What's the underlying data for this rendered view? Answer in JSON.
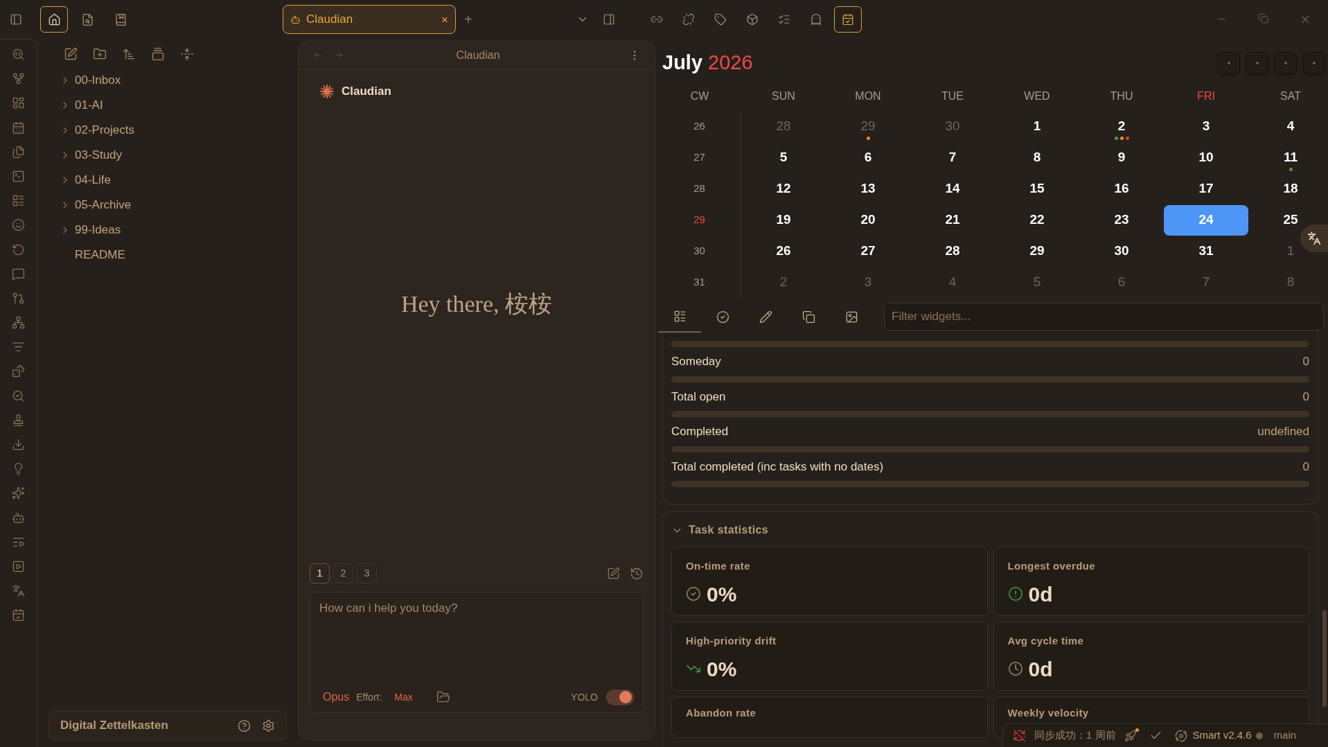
{
  "top_left_tabs": [
    {
      "selected": true
    },
    {
      "selected": false
    },
    {
      "selected": false
    }
  ],
  "tab": {
    "title": "Claudian",
    "close": "×",
    "new": "+"
  },
  "right_tools": [
    {
      "selected": false
    },
    {
      "selected": false
    },
    {
      "selected": false
    },
    {
      "selected": false
    },
    {
      "selected": false
    },
    {
      "selected": false
    },
    {
      "selected": true
    }
  ],
  "explorer": {
    "items": [
      {
        "kind": "folder",
        "label": "00-Inbox",
        "expanded": false
      },
      {
        "kind": "folder",
        "label": "01-AI",
        "expanded": false
      },
      {
        "kind": "folder",
        "label": "02-Projects",
        "expanded": false
      },
      {
        "kind": "folder",
        "label": "03-Study",
        "expanded": false
      },
      {
        "kind": "folder",
        "label": "04-Life",
        "expanded": false
      },
      {
        "kind": "folder",
        "label": "05-Archive",
        "expanded": false
      },
      {
        "kind": "folder",
        "label": "99-Ideas",
        "expanded": false
      },
      {
        "kind": "file",
        "label": "README"
      }
    ],
    "vault": "Digital Zettelkasten"
  },
  "chat": {
    "header": "Claudian",
    "title": "Claudian",
    "greeting": "Hey there, 桉桉",
    "sessions": [
      {
        "label": "1",
        "selected": true
      },
      {
        "label": "2",
        "selected": false
      },
      {
        "label": "3",
        "selected": false
      }
    ],
    "placeholder": "How can i help you today?",
    "model": "Opus",
    "effort_label": "Effort:",
    "effort": "Max",
    "yolo_label": "YOLO",
    "yolo_on": true
  },
  "calendar": {
    "month": "July",
    "year": "2026",
    "headers": [
      {
        "label": "CW",
        "today": false
      },
      {
        "label": "SUN",
        "today": false
      },
      {
        "label": "MON",
        "today": false
      },
      {
        "label": "TUE",
        "today": false
      },
      {
        "label": "WED",
        "today": false
      },
      {
        "label": "THU",
        "today": false
      },
      {
        "label": "FRI",
        "today": true
      },
      {
        "label": "SAT",
        "today": false
      }
    ],
    "weeks": [
      {
        "cw": "26",
        "current": false,
        "days": [
          {
            "label": "28",
            "muted": true,
            "selected": false
          },
          {
            "label": "29",
            "muted": true,
            "selected": false,
            "dots": [
              {
                "color": "#f0901e"
              }
            ]
          },
          {
            "label": "30",
            "muted": true,
            "selected": false
          },
          {
            "label": "1",
            "muted": false,
            "selected": false
          },
          {
            "label": "2",
            "muted": false,
            "selected": false,
            "dots": [
              {
                "color": "#43a047"
              },
              {
                "color": "#f0901e"
              },
              {
                "color": "#e53935"
              }
            ]
          },
          {
            "label": "3",
            "muted": false,
            "selected": false
          },
          {
            "label": "4",
            "muted": false,
            "selected": false
          }
        ]
      },
      {
        "cw": "27",
        "current": false,
        "days": [
          {
            "label": "5",
            "muted": false,
            "selected": false
          },
          {
            "label": "6",
            "muted": false,
            "selected": false
          },
          {
            "label": "7",
            "muted": false,
            "selected": false
          },
          {
            "label": "8",
            "muted": false,
            "selected": false
          },
          {
            "label": "9",
            "muted": false,
            "selected": false
          },
          {
            "label": "10",
            "muted": false,
            "selected": false
          },
          {
            "label": "11",
            "muted": false,
            "selected": false,
            "dots": [
              {
                "color": "#43a047"
              }
            ]
          }
        ]
      },
      {
        "cw": "28",
        "current": false,
        "days": [
          {
            "label": "12",
            "muted": false,
            "selected": false
          },
          {
            "label": "13",
            "muted": false,
            "selected": false
          },
          {
            "label": "14",
            "muted": false,
            "selected": false
          },
          {
            "label": "15",
            "muted": false,
            "selected": false
          },
          {
            "label": "16",
            "muted": false,
            "selected": false
          },
          {
            "label": "17",
            "muted": false,
            "selected": false
          },
          {
            "label": "18",
            "muted": false,
            "selected": false
          }
        ]
      },
      {
        "cw": "29",
        "current": true,
        "days": [
          {
            "label": "19",
            "muted": false,
            "selected": false
          },
          {
            "label": "20",
            "muted": false,
            "selected": false
          },
          {
            "label": "21",
            "muted": false,
            "selected": false
          },
          {
            "label": "22",
            "muted": false,
            "selected": false
          },
          {
            "label": "23",
            "muted": false,
            "selected": false
          },
          {
            "label": "24",
            "muted": false,
            "selected": true
          },
          {
            "label": "25",
            "muted": false,
            "selected": false
          }
        ]
      },
      {
        "cw": "30",
        "current": false,
        "days": [
          {
            "label": "26",
            "muted": false,
            "selected": false
          },
          {
            "label": "27",
            "muted": false,
            "selected": false
          },
          {
            "label": "28",
            "muted": false,
            "selected": false
          },
          {
            "label": "29",
            "muted": false,
            "selected": false
          },
          {
            "label": "30",
            "muted": false,
            "selected": false
          },
          {
            "label": "31",
            "muted": false,
            "selected": false
          },
          {
            "label": "1",
            "muted": true,
            "selected": false
          }
        ]
      },
      {
        "cw": "31",
        "current": false,
        "days": [
          {
            "label": "2",
            "muted": true,
            "selected": false
          },
          {
            "label": "3",
            "muted": true,
            "selected": false
          },
          {
            "label": "4",
            "muted": true,
            "selected": false
          },
          {
            "label": "5",
            "muted": true,
            "selected": false
          },
          {
            "label": "6",
            "muted": true,
            "selected": false
          },
          {
            "label": "7",
            "muted": true,
            "selected": false
          },
          {
            "label": "8",
            "muted": true,
            "selected": false
          }
        ]
      }
    ]
  },
  "widget_tabs": [
    {
      "selected": true
    },
    {
      "selected": false
    },
    {
      "selected": false
    },
    {
      "selected": false
    },
    {
      "selected": false
    }
  ],
  "filter": {
    "placeholder": "Filter widgets..."
  },
  "stats": [
    {
      "label": "Someday",
      "value": "0",
      "level": 0
    },
    {
      "label": "Total open",
      "value": "0",
      "level": 0
    },
    {
      "label": "Completed",
      "value": "undefined",
      "level": 0
    },
    {
      "label": "Total completed (inc tasks with no dates)",
      "value": "0",
      "level": 0
    }
  ],
  "task_statistics": {
    "title": "Task statistics",
    "expanded": true,
    "cards": [
      {
        "label": "On-time rate",
        "value": "0%",
        "kind": "check"
      },
      {
        "label": "Longest overdue",
        "value": "0d",
        "kind": "alert"
      },
      {
        "label": "High-priority drift",
        "value": "0%",
        "kind": "trend"
      },
      {
        "label": "Avg cycle time",
        "value": "0d",
        "kind": "clock"
      },
      {
        "label": "Abandon rate",
        "kind": "cut"
      },
      {
        "label": "Weekly velocity",
        "kind": "cut"
      }
    ]
  },
  "status_bar": {
    "sync": "同步成功：1 周前",
    "smart": "Smart v2.4.6",
    "branch": "main"
  }
}
